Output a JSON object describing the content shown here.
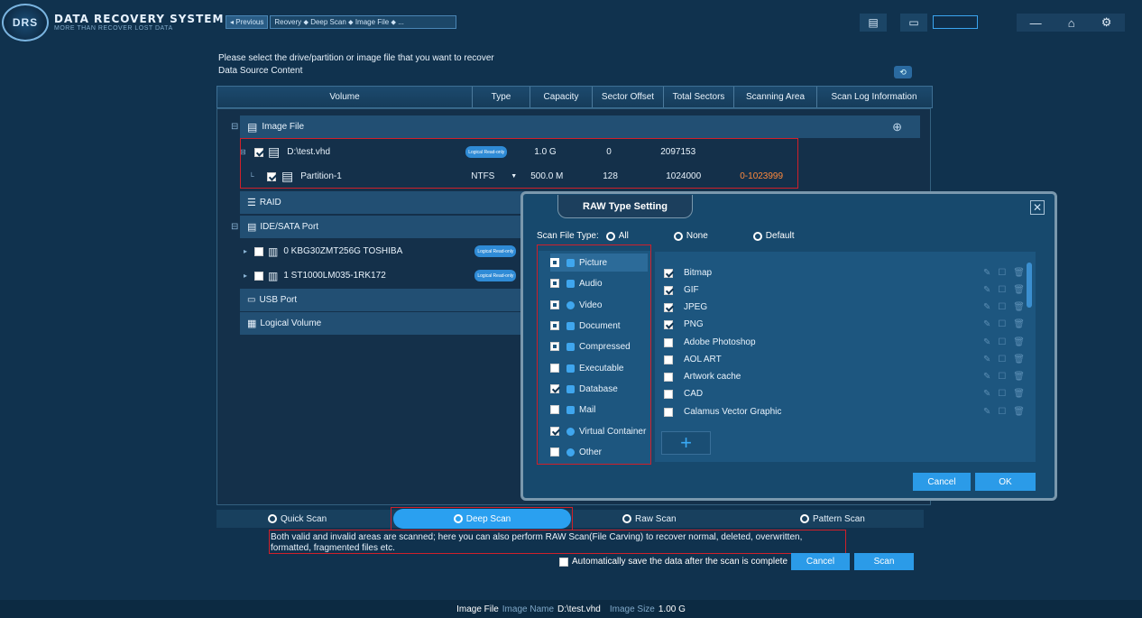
{
  "header": {
    "logo_text": "DRS",
    "title": "DATA RECOVERY SYSTEM",
    "subtitle": "MORE THAN RECOVER LOST DATA",
    "prev_label": "◂ Previous",
    "breadcrumb": "Reovery ⬥ Deep Scan ⬥ Image File ⬥ ..."
  },
  "main": {
    "prompt": "Please select the drive/partition or image file that you want to recover",
    "section_label": "Data Source Content"
  },
  "columns": [
    "Volume",
    "Type",
    "Capacity",
    "Sector Offset",
    "Total Sectors",
    "Scanning Area",
    "Scan Log Information"
  ],
  "tree": {
    "image_file": "Image File",
    "vhd": {
      "name": "D:\\test.vhd",
      "badge": "Logical\nRead-only",
      "capacity": "1.0 G",
      "offset": "0",
      "total": "2097153"
    },
    "partition": {
      "name": "Partition-1",
      "type": "NTFS",
      "capacity": "500.0 M",
      "offset": "128",
      "total": "1024000",
      "area": "0-1023999"
    },
    "raid": "RAID",
    "ide": "IDE/SATA Port",
    "disk1": {
      "name": "0  KBG30ZMT256G TOSHIBA",
      "badge": "Logical\nRead-only"
    },
    "disk2": {
      "name": "1  ST1000LM035-1RK172",
      "badge": "Logical\nRead-only"
    },
    "usb": "USB Port",
    "logical": "Logical Volume"
  },
  "dialog": {
    "title": "RAW Type Setting",
    "scan_file_type": "Scan File Type:",
    "opt_all": "All",
    "opt_none": "None",
    "opt_default": "Default",
    "categories": [
      {
        "label": "Picture",
        "state": "partial"
      },
      {
        "label": "Audio",
        "state": "partial"
      },
      {
        "label": "Video",
        "state": "partial"
      },
      {
        "label": "Document",
        "state": "partial"
      },
      {
        "label": "Compressed",
        "state": "partial"
      },
      {
        "label": "Executable",
        "state": "off"
      },
      {
        "label": "Database",
        "state": "on"
      },
      {
        "label": "Mail",
        "state": "off"
      },
      {
        "label": "Virtual Container",
        "state": "on"
      },
      {
        "label": "Other",
        "state": "off"
      }
    ],
    "types": [
      {
        "label": "Bitmap",
        "checked": true
      },
      {
        "label": "GIF",
        "checked": true
      },
      {
        "label": "JPEG",
        "checked": true
      },
      {
        "label": "PNG",
        "checked": true
      },
      {
        "label": "Adobe Photoshop",
        "checked": false
      },
      {
        "label": "AOL ART",
        "checked": false
      },
      {
        "label": "Artwork cache",
        "checked": false
      },
      {
        "label": "CAD",
        "checked": false
      },
      {
        "label": "Calamus Vector Graphic",
        "checked": false
      }
    ],
    "add_label": "+",
    "cancel": "Cancel",
    "ok": "OK"
  },
  "modes": {
    "quick": "Quick Scan",
    "deep": "Deep Scan",
    "raw": "Raw Scan",
    "pattern": "Pattern Scan"
  },
  "description": "Both valid and invalid areas are scanned; here you can also perform RAW Scan(File Carving) to recover normal, deleted, overwritten, formatted, fragmented files etc.",
  "autosave": "Automatically save the data after the scan is complete",
  "buttons": {
    "cancel": "Cancel",
    "scan": "Scan"
  },
  "status": {
    "label": "Image File",
    "name_label": "Image Name",
    "name": "D:\\test.vhd",
    "size_label": "Image Size",
    "size": "1.00 G"
  },
  "colors": {
    "accent": "#2b9be8",
    "highlight": "#d0202a",
    "background": "#10324e"
  }
}
